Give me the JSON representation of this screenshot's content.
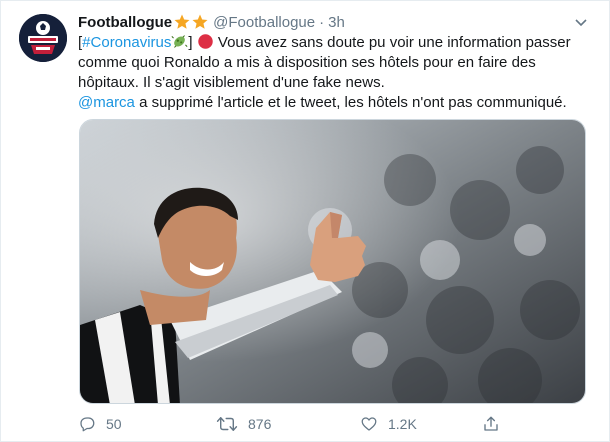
{
  "tweet": {
    "author_name": "Footballogue",
    "star_icons": [
      "star-icon",
      "star-icon"
    ],
    "handle": "@Footballogue",
    "separator": "·",
    "time": "3h",
    "text": {
      "line1_bracket_open": "[",
      "hashtag": "#Coronavirus",
      "line1_bracket_close": "]",
      "line1_rest": " Vous avez sans doute pu voir une information passer",
      "line2": "comme quoi Ronaldo a mis à disposition ses hôtels pour en faire des",
      "line3": "hôpitaux. Il s'agit visiblement d'une fake news.",
      "mention": "@marca",
      "line4_rest": " a supprimé l'article et le tweet, les hôtels n'ont pas communiqué."
    },
    "media": {
      "description_icon": "photo-thumbs-up-player"
    },
    "actions": {
      "reply_count": "50",
      "retweet_count": "876",
      "like_count": "1.2K"
    },
    "colors": {
      "link": "#1b95e0",
      "secondary_text": "#657786",
      "star": "#f5a623",
      "red_circle": "#dd2e44",
      "microbe": "#77b255"
    }
  }
}
